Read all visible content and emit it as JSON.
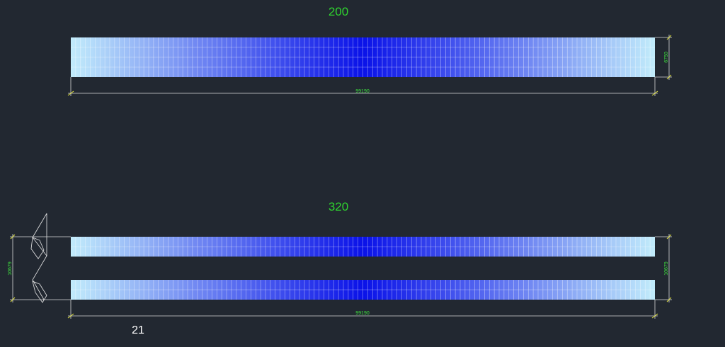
{
  "drawing": {
    "top_view_label": "200",
    "bottom_view_label": "320",
    "top_width_dim": "99190",
    "top_height_dim": "6750",
    "bottom_width_dim": "99190",
    "bottom_height_dim_right": "10679",
    "bottom_height_dim_left": "10679",
    "note": "21"
  },
  "colors": {
    "background": "#222831",
    "panel_edge": "#b8e4f7",
    "panel_center": "#0a12e8",
    "dimension_text": "#3ee03e",
    "dimension_tick": "#e6e640"
  }
}
